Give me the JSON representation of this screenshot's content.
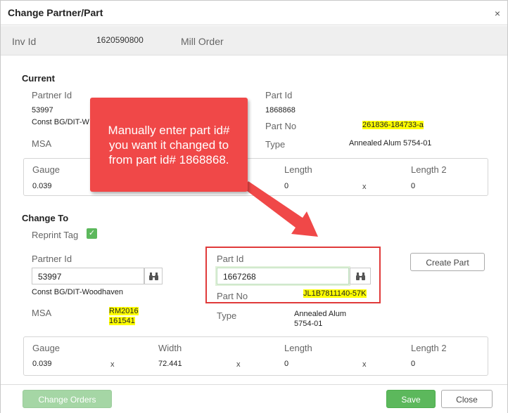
{
  "dialog": {
    "title": "Change Partner/Part",
    "close_glyph": "×"
  },
  "info": {
    "inv_id_label": "Inv Id",
    "inv_id_value": "1620590800",
    "mill_order_label": "Mill Order"
  },
  "current": {
    "title": "Current",
    "partner_id_label": "Partner Id",
    "partner_id_value": "53997",
    "partner_name": "Const BG/DIT-W",
    "msa_label": "MSA",
    "part_id_label": "Part Id",
    "part_id_value": "1868868",
    "part_no_label": "Part No",
    "part_no_value": "261836-184733-a",
    "type_label": "Type",
    "type_value": "Annealed Alum 5754-01",
    "gauge_label": "Gauge",
    "gauge_value": "0.039",
    "length_label": "Length",
    "length_value": "0",
    "x_sign": "x",
    "length2_label": "Length 2",
    "length2_value": "0"
  },
  "change_to": {
    "title": "Change To",
    "reprint_label": "Reprint Tag",
    "reprint_checked": true,
    "partner_id_label": "Partner Id",
    "partner_id_value": "53997",
    "partner_name": "Const BG/DIT-Woodhaven",
    "msa_label": "MSA",
    "msa_line1": "RM2016",
    "msa_line2": "161541",
    "part_id_label": "Part Id",
    "part_id_value": "1667268",
    "part_no_label": "Part No",
    "part_no_value": "JL1B7811140-57K",
    "type_label": "Type",
    "type_line1": "Annealed Alum",
    "type_line2": "5754-01",
    "create_part_label": "Create Part",
    "gauge_label": "Gauge",
    "gauge_value": "0.039",
    "width_label": "Width",
    "width_value": "72.441",
    "length_label": "Length",
    "length_value": "0",
    "length2_label": "Length 2",
    "length2_value": "0",
    "x_sign": "x"
  },
  "footer": {
    "change_orders_label": "Change Orders",
    "save_label": "Save",
    "close_label": "Close"
  },
  "annotation": {
    "callout_line1": "Manually enter part id#",
    "callout_line2": "you want it changed to",
    "callout_line3": "from part id# 1868868."
  },
  "colors": {
    "accent_green": "#5cb85c",
    "highlight": "#ffff00",
    "callout_red": "#f04848"
  }
}
